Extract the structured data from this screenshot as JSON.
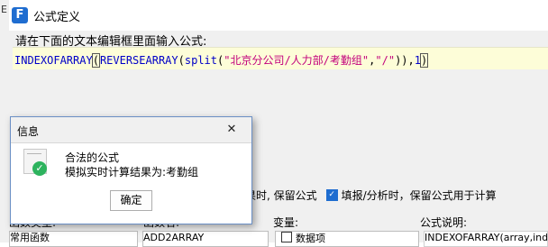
{
  "edge": {
    "glyph": "E"
  },
  "window": {
    "title": "公式定义",
    "logo_letter": "F"
  },
  "instruction": "请在下面的文本编辑框里面输入公式:",
  "formula": {
    "fn1": "INDEXOFARRAY",
    "open1": "(",
    "fn2": "REVERSEARRAY",
    "open2": "(",
    "fn3": "split",
    "open3": "(",
    "str1": "\"北京分公司/人力部/考勤组\"",
    "comma1": ",",
    "str2": "\"/\"",
    "close": ")),",
    "num": "1",
    "end": ")"
  },
  "options": {
    "partial_label": "果时, 保留公式",
    "checkbox_label": "填报/分析时，保留公式用于计算",
    "checkbox_checked": true
  },
  "bottom": {
    "type_label": "函数类型:",
    "name_label": "函数名:",
    "var_label": "变量:",
    "desc_label": "公式说明:",
    "type_value": "常用函数",
    "name_value": "ADD2ARRAY",
    "var_value": "数据项",
    "desc_value": "INDEXOFARRAY(array,ind"
  },
  "dialog": {
    "title": "信息",
    "close_glyph": "✕",
    "message_line1": "合法的公式",
    "message_line2": "模拟实时计算结果为:考勤组",
    "ok_label": "确定",
    "check_glyph": "✓"
  },
  "colors": {
    "function": "#0000c8",
    "string": "#c2007c",
    "editor_bg": "#fdfdd8",
    "accent": "#1f6dd0",
    "success": "#2db35e"
  }
}
